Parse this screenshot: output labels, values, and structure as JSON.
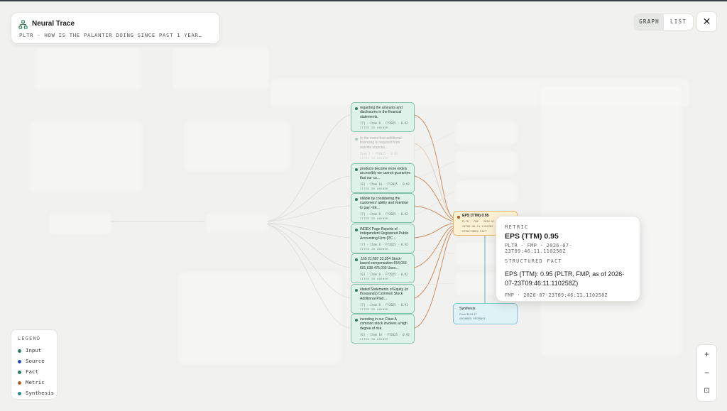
{
  "app": {
    "name": "Neural Trace",
    "query": "PLTR - HOW IS THE PALANTIR DOING SINCE PAST 1 YEAR…"
  },
  "view_toggle": {
    "graph": "GRAPH",
    "list": "LIST",
    "active": "graph"
  },
  "fact_nodes": [
    {
      "text": "regarding the amounts and disclosures in the financial statements.",
      "meta": "[7] · Item 8 · FY2025 · 0.92",
      "tag": "CITED IN ANSWER"
    },
    {
      "text": "In the event that additional financing is required from outside sources…",
      "meta": "Item 7 · FY2025 · 0.91",
      "tag": "CITED IN ANSWER"
    },
    {
      "text": "products become more widely accessibly we cannot guarantee that our cu…",
      "meta": "[6] · Item 1A · FY2025 · 0.92",
      "tag": "CITED IN ANSWER"
    },
    {
      "text": "ollable by considering the customers' ability and intention to pay.~hE…",
      "meta": "[7] · Item 8 · FY2025 · 0.92",
      "tag": "CITED IN ANSWER"
    },
    {
      "text": "INDEX Page Reports of Independent Registered Public Accounting Firm (PC…",
      "meta": "[7] · Item 8 · FY2025 · 0.92",
      "tag": "CITED IN ANSWER"
    },
    {
      "text": ",165 21,687 33,354 Stock-based compensation 654,033 691,638 475,003 Uses…",
      "meta": "[6] · Item 8 · FY2025 · 0.92",
      "tag": "CITED IN ANSWER"
    },
    {
      "text": "idated Statements of Equity (in thousands) Common Stock Additional Paid…",
      "meta": "[7] · Item 8 · FY2025 · 0.91",
      "tag": "CITED IN ANSWER"
    },
    {
      "text": "investing in our Class A common stock involves a high degree of risk.",
      "meta": "[6] · Item 1A · FY2025 · 0.92",
      "tag": "CITED IN ANSWER"
    }
  ],
  "metric_node": {
    "title": "EPS (TTM) 0.95",
    "meta1": "PLTR · FMP · 2026-07-",
    "meta2": "23T09:46:11.110258Z",
    "tag": "STRUCTURED FACT"
  },
  "synthesis_node": {
    "title": "Synthesis",
    "meta": "Price $124.37",
    "tag": "GROUNDED RESPONSE"
  },
  "tooltip": {
    "kind": "METRIC",
    "title": "EPS (TTM) 0.95",
    "subtitle": "PLTR · FMP · 2026-07-23T09:46:11.110258Z",
    "fact_type": "STRUCTURED FACT",
    "body": "EPS (TTM): 0.95 (PLTR, FMP, as of 2026-07-23T09:46:11.110258Z)",
    "footer": "FMP · 2026-07-23T09:46:11.110258Z"
  },
  "legend": {
    "title": "LEGEND",
    "items": [
      {
        "label": "Input",
        "color": "#2f7d5b"
      },
      {
        "label": "Source",
        "color": "#2b4fc2"
      },
      {
        "label": "Fact",
        "color": "#2f7d5b"
      },
      {
        "label": "Metric",
        "color": "#b0622a"
      },
      {
        "label": "Synthesis",
        "color": "#2f8791"
      }
    ]
  },
  "zoom": {
    "in": "+",
    "out": "−",
    "fit": "⊡"
  },
  "colors": {
    "fact_edge": "#c9824e",
    "metric_fill": "#fdf1d4",
    "fact_fill": "#dff2ea",
    "synth_fill": "#dff2f5"
  }
}
